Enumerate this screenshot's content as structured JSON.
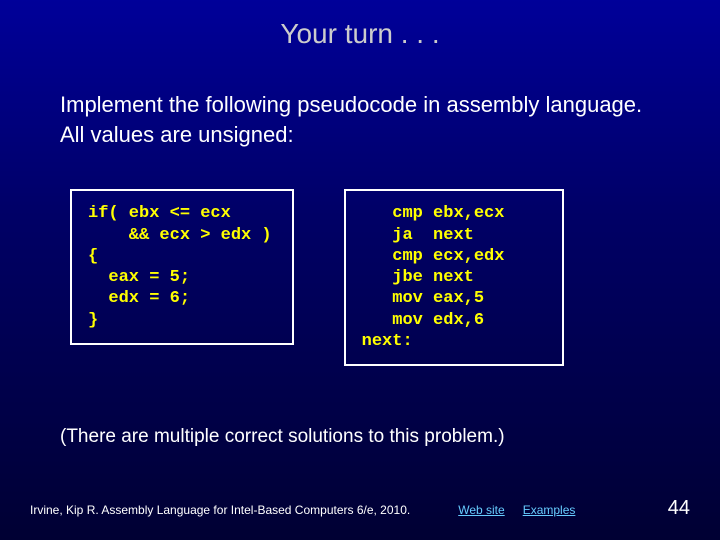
{
  "title": "Your turn . . .",
  "prompt": "Implement the following pseudocode in assembly language. All values are unsigned:",
  "code_left": "if( ebx <= ecx\n    && ecx > edx )\n{\n  eax = 5;\n  edx = 6;\n}",
  "code_right": "   cmp ebx,ecx\n   ja  next\n   cmp ecx,edx\n   jbe next\n   mov eax,5\n   mov edx,6\nnext:",
  "note": "(There are multiple correct solutions to this problem.)",
  "footer": {
    "citation": "Irvine, Kip R. Assembly Language for Intel-Based Computers 6/e, 2010.",
    "link_web": "Web site",
    "link_examples": "Examples",
    "page": "44"
  }
}
